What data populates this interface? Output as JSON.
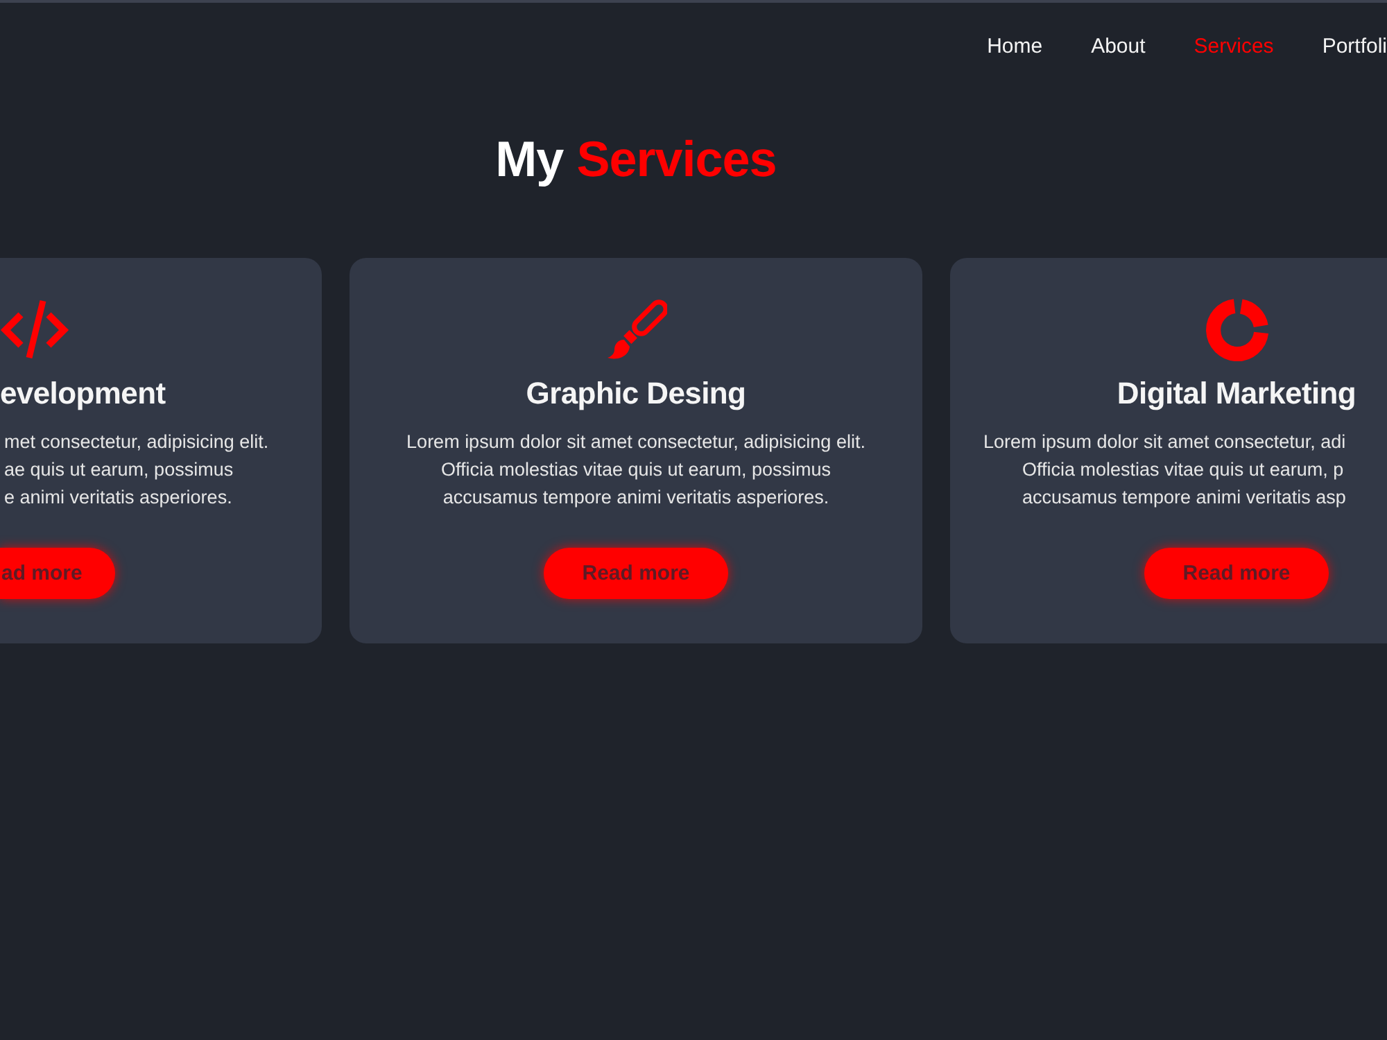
{
  "nav": [
    {
      "label": "Home",
      "selected": false
    },
    {
      "label": "About",
      "selected": false
    },
    {
      "label": "Services",
      "selected": true
    },
    {
      "label": "Portfoli",
      "selected": false
    }
  ],
  "heading": {
    "text": "My",
    "accent": "Services"
  },
  "cards": [
    {
      "title": "evelopment",
      "body": "met consectetur, adipisicing elit.\nae quis ut earum, possimus\ne animi veritatis asperiores.",
      "button": "ad more",
      "clipped_left": true,
      "clipped_right": false
    },
    {
      "title": "Graphic Desing",
      "body": "Lorem ipsum dolor sit amet consectetur, adipisicing elit.\nOfficia molestias vitae quis ut earum, possimus\naccusamus tempore animi veritatis asperiores.",
      "button": "Read more",
      "clipped_left": false,
      "clipped_right": false
    },
    {
      "title": "Digital Marketing",
      "body": "Lorem ipsum dolor sit amet consectetur, adi\nOfficia molestias vitae quis ut earum, p\naccusamus tempore animi veritatis asp",
      "button": "Read more",
      "clipped_left": false,
      "clipped_right": true
    }
  ]
}
